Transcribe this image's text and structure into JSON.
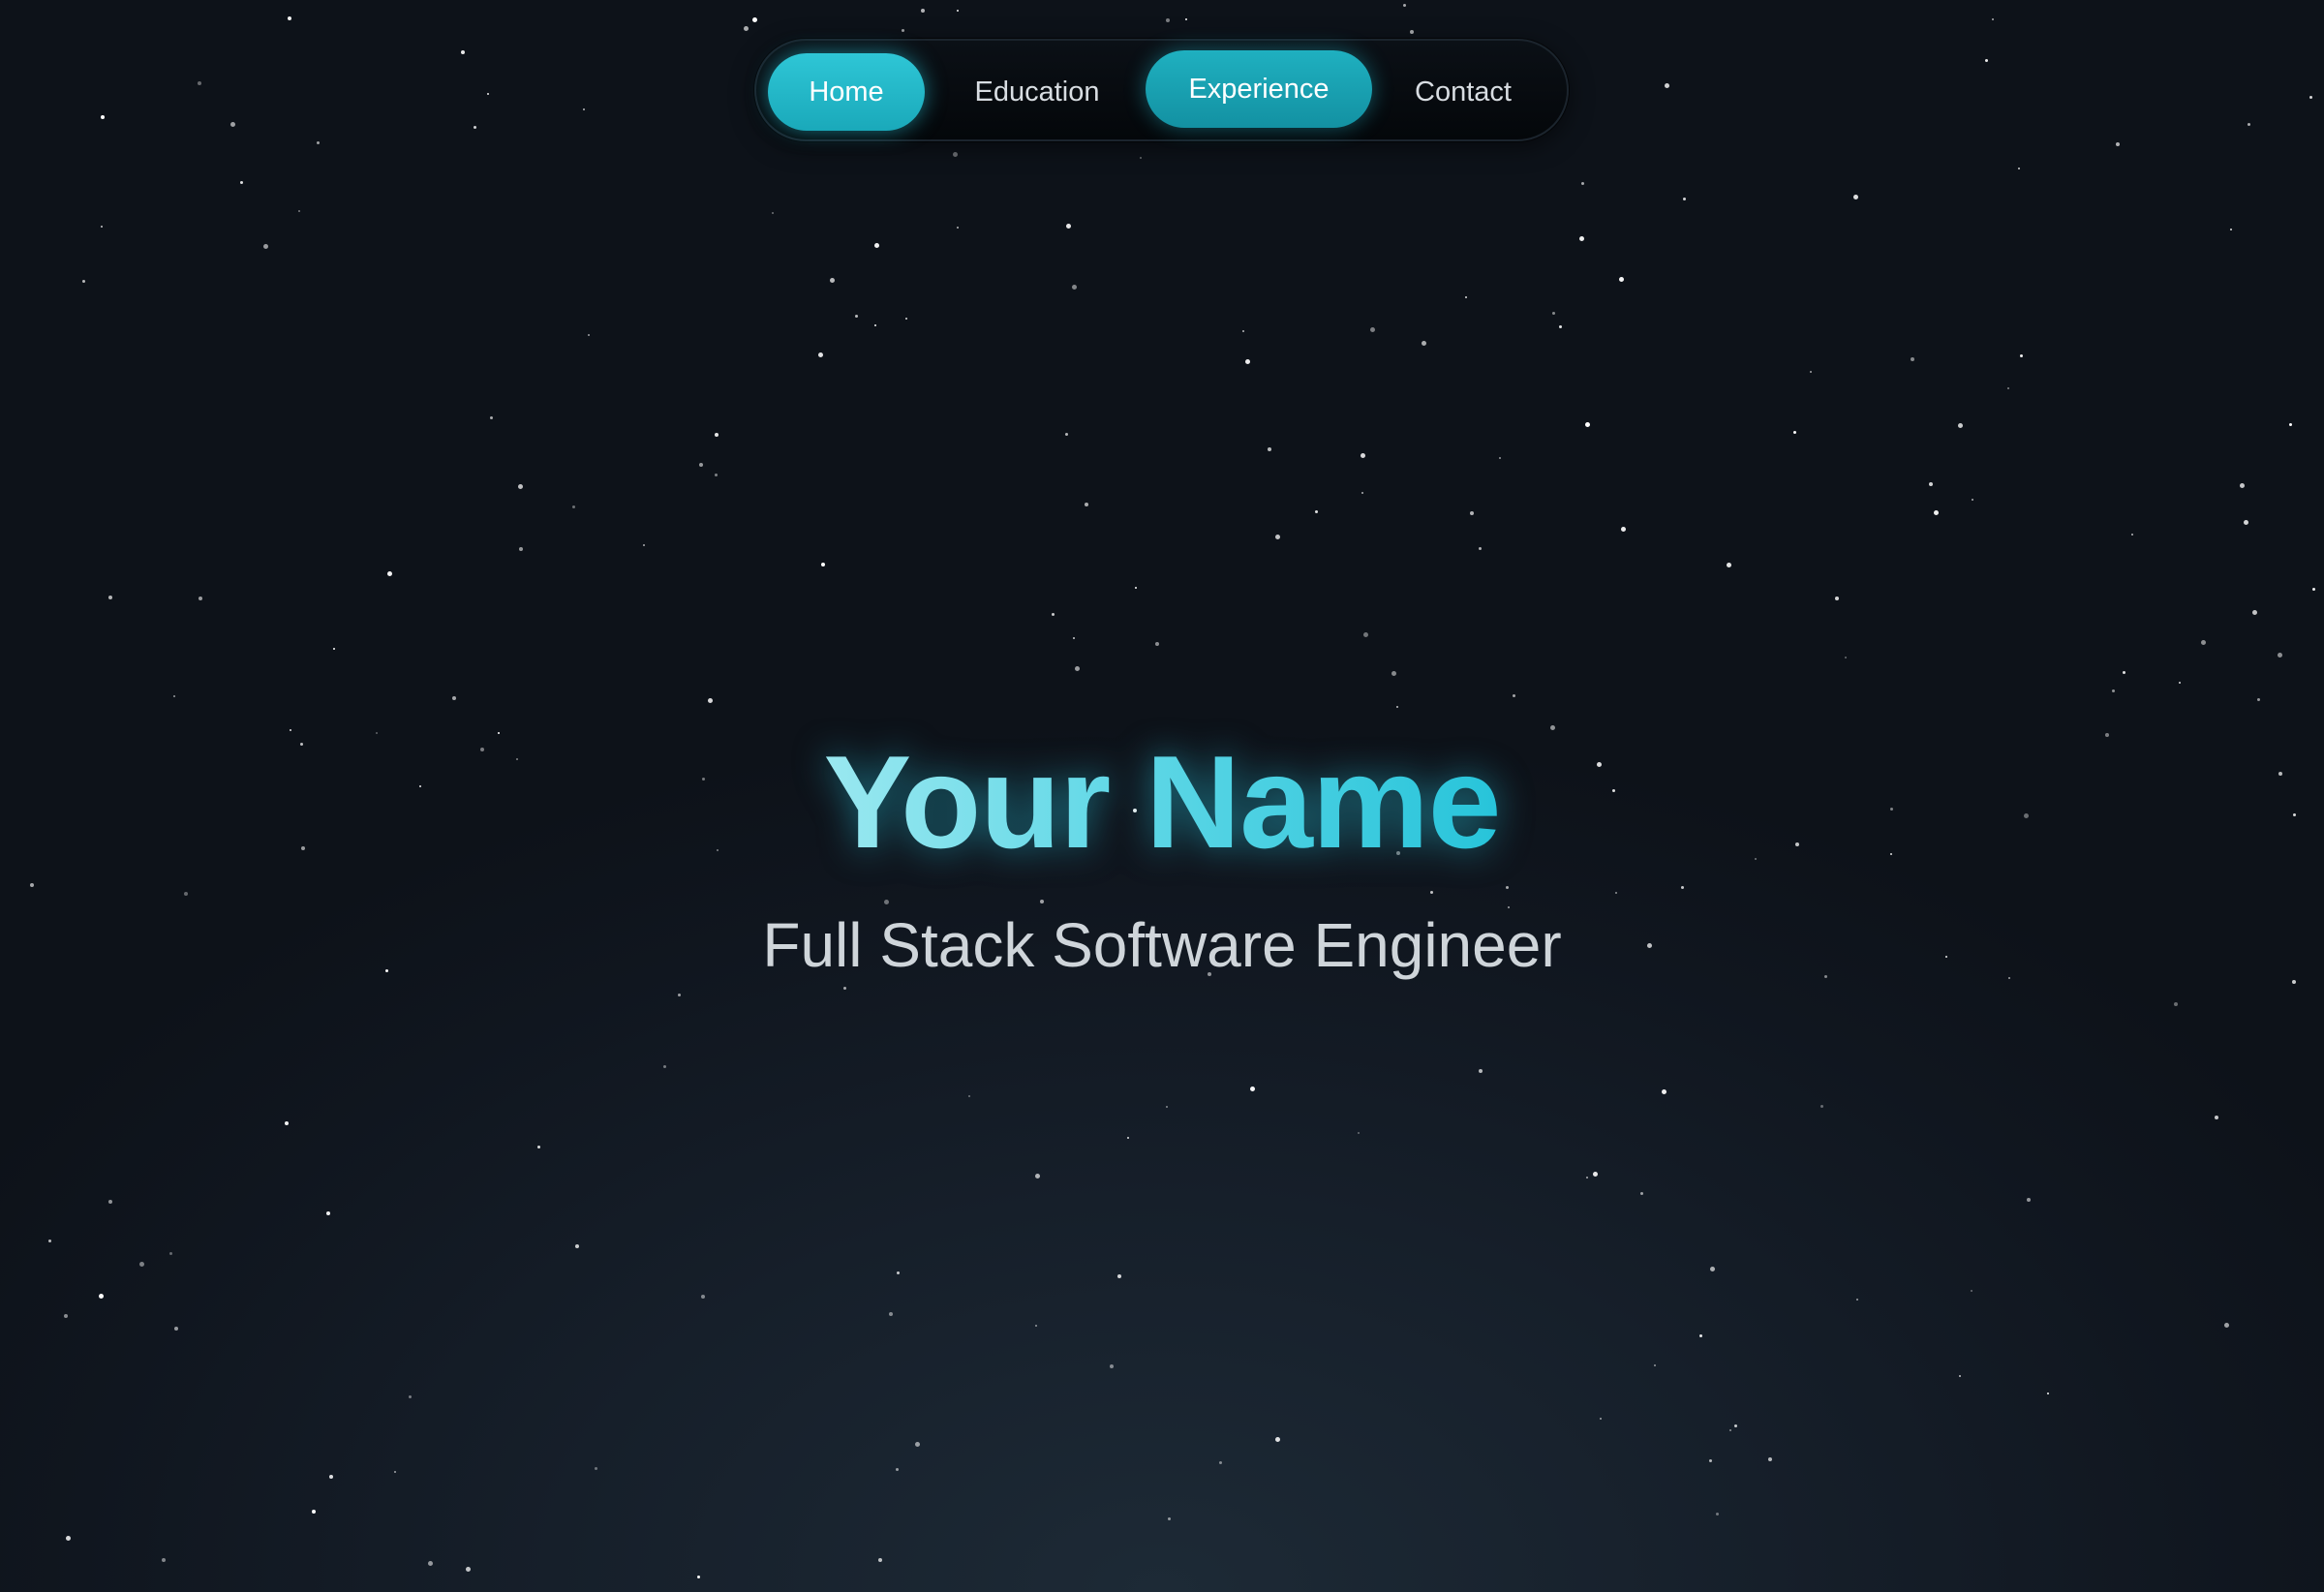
{
  "nav": {
    "items": [
      {
        "label": "Home",
        "active": true
      },
      {
        "label": "Education",
        "active": false
      },
      {
        "label": "Experience",
        "active": false
      },
      {
        "label": "Contact",
        "active": false
      }
    ]
  },
  "hero": {
    "name": "Your Name",
    "subtitle": "Full Stack Software Engineer"
  },
  "colors": {
    "accent": "#22c0d4",
    "background": "#10161f",
    "text": "#cfd5da"
  }
}
